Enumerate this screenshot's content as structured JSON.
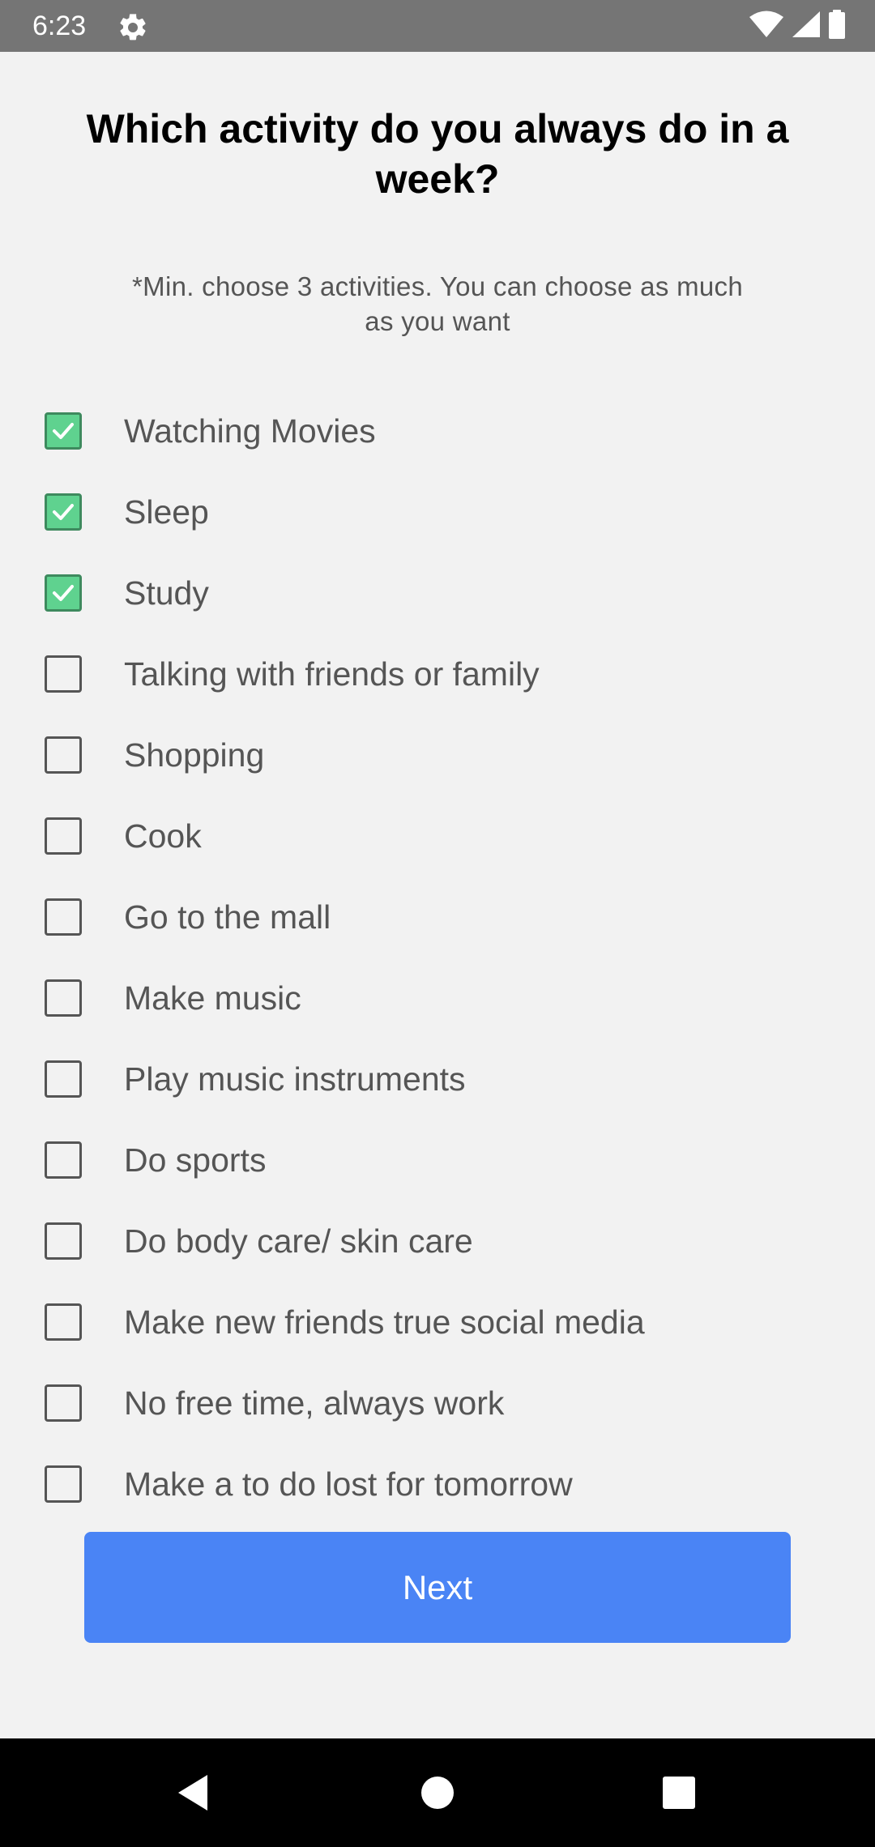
{
  "status_bar": {
    "time": "6:23",
    "icons": [
      "gear-icon",
      "wifi-icon",
      "signal-icon",
      "battery-icon"
    ]
  },
  "screen": {
    "title": "Which activity do you always do in a week?",
    "subtitle": "*Min. choose 3 activities. You can choose as much as you want"
  },
  "activities": [
    {
      "label": "Watching Movies",
      "checked": true
    },
    {
      "label": "Sleep",
      "checked": true
    },
    {
      "label": "Study",
      "checked": true
    },
    {
      "label": "Talking with friends or family",
      "checked": false
    },
    {
      "label": "Shopping",
      "checked": false
    },
    {
      "label": "Cook",
      "checked": false
    },
    {
      "label": "Go to the mall",
      "checked": false
    },
    {
      "label": "Make music",
      "checked": false
    },
    {
      "label": "Play music instruments",
      "checked": false
    },
    {
      "label": "Do sports",
      "checked": false
    },
    {
      "label": "Do body care/ skin care",
      "checked": false
    },
    {
      "label": "Make new friends true social media",
      "checked": false
    },
    {
      "label": "No free time, always work",
      "checked": false
    },
    {
      "label": "Make a to do lost for tomorrow",
      "checked": false
    }
  ],
  "next_button": {
    "label": "Next"
  },
  "nav_bar": {
    "icons": [
      "back-icon",
      "home-icon",
      "recents-icon"
    ]
  },
  "colors": {
    "status_bar": "#757575",
    "background": "#f2f2f2",
    "checkbox_checked": "#5fd28f",
    "button": "#4a84f5",
    "nav_bar": "#000000"
  }
}
